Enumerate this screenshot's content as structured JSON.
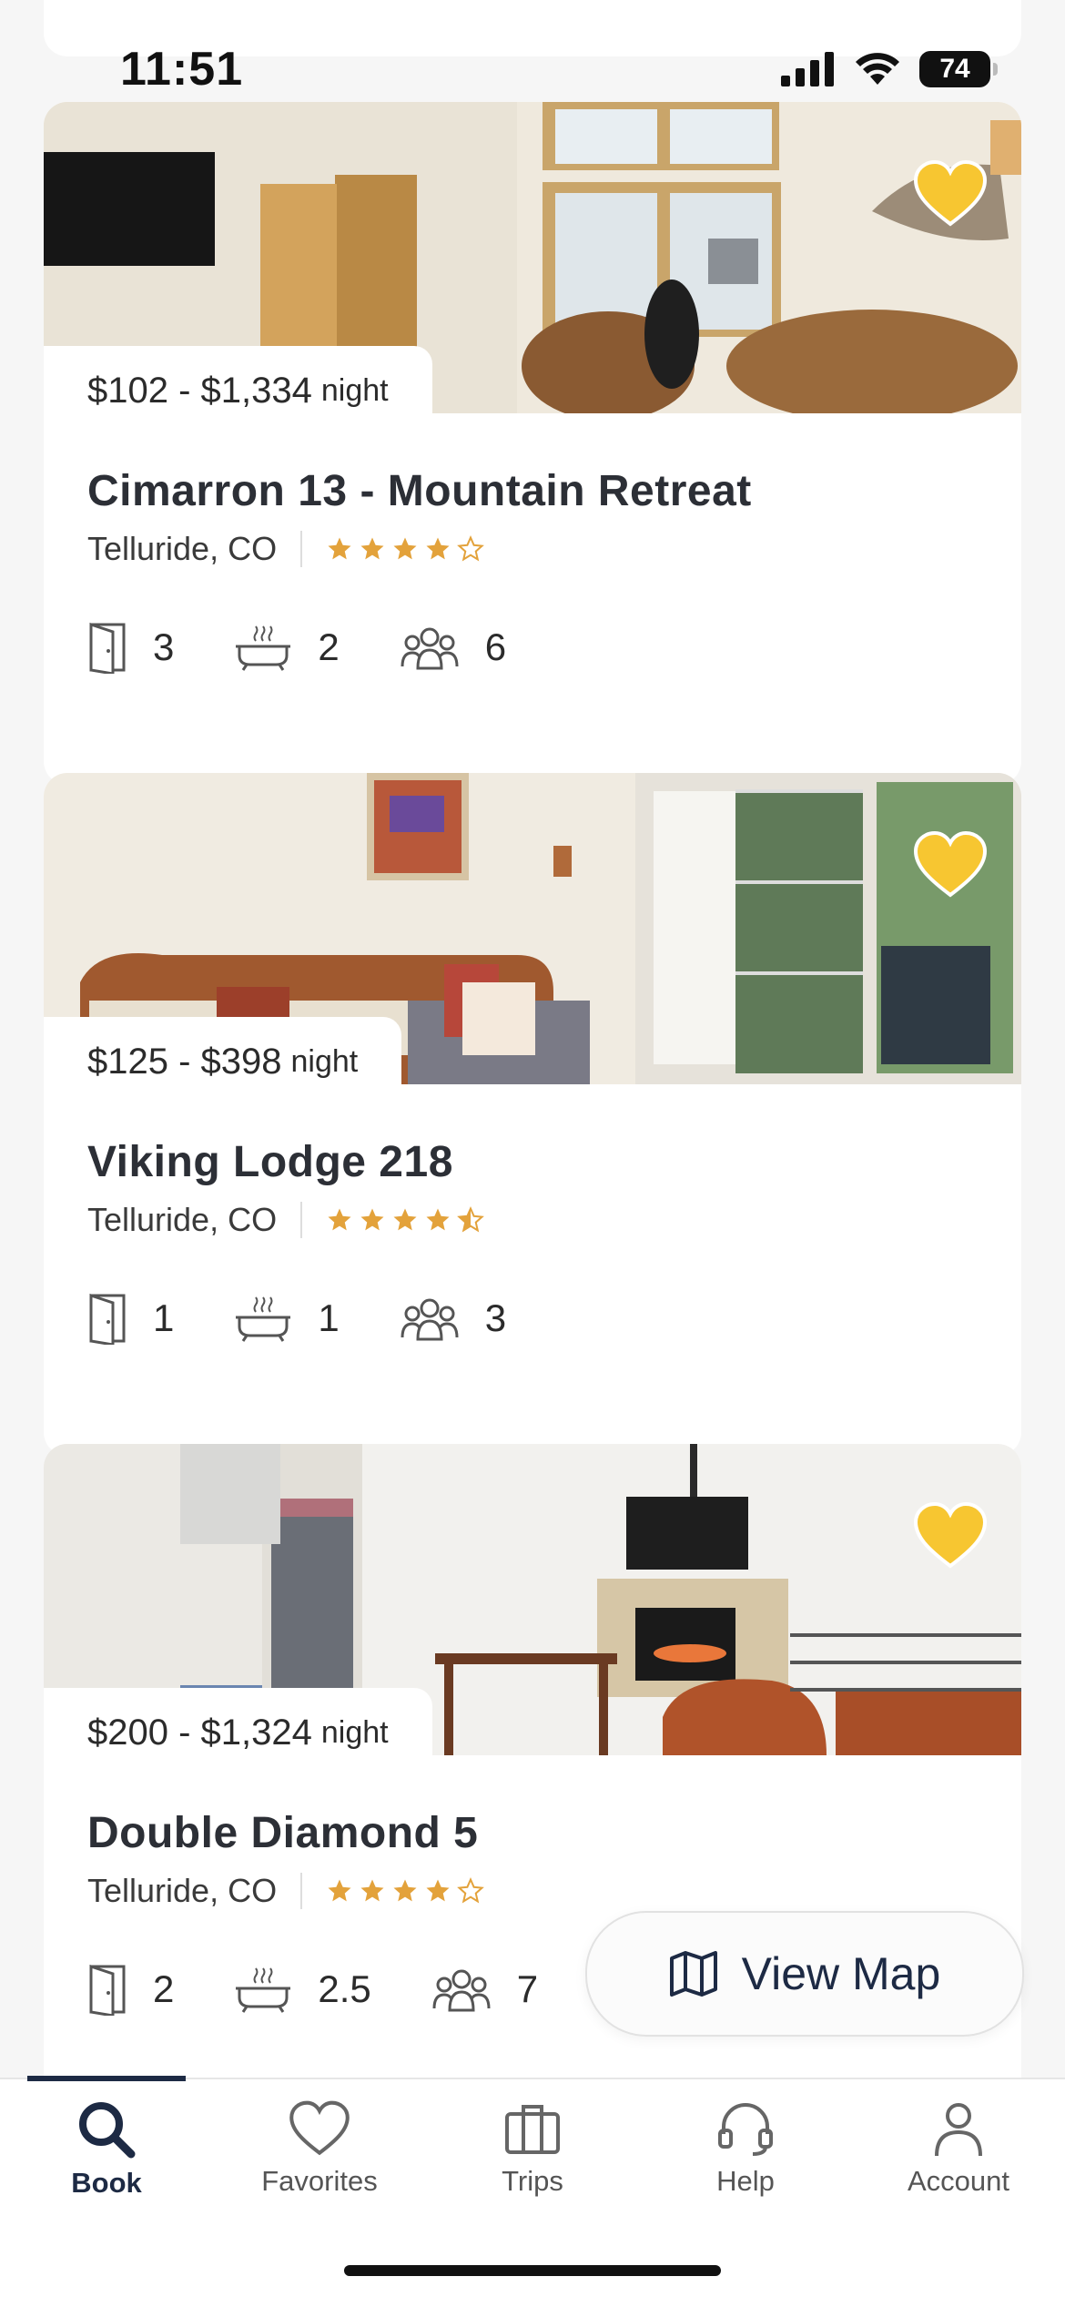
{
  "status_bar": {
    "time": "11:51",
    "battery": "74"
  },
  "listings": [
    {
      "price": "$102 - $1,334",
      "price_unit": "night",
      "title": "Cimarron 13 - Mountain Retreat",
      "location": "Telluride, CO",
      "rating": 4,
      "bedrooms": "3",
      "bathrooms": "2",
      "guests": "6",
      "favorited": true
    },
    {
      "price": "$125 - $398",
      "price_unit": "night",
      "title": "Viking Lodge 218",
      "location": "Telluride, CO",
      "rating": 4.5,
      "bedrooms": "1",
      "bathrooms": "1",
      "guests": "3",
      "favorited": true
    },
    {
      "price": "$200 - $1,324",
      "price_unit": "night",
      "title": "Double Diamond 5",
      "location": "Telluride, CO",
      "rating": 4,
      "bedrooms": "2",
      "bathrooms": "2.5",
      "guests": "7",
      "favorited": true
    }
  ],
  "view_map": {
    "label": "View Map"
  },
  "tabs": [
    {
      "label": "Book",
      "icon": "search-icon",
      "active": true
    },
    {
      "label": "Favorites",
      "icon": "heart-icon"
    },
    {
      "label": "Trips",
      "icon": "briefcase-icon"
    },
    {
      "label": "Help",
      "icon": "headset-icon"
    },
    {
      "label": "Account",
      "icon": "person-icon"
    }
  ],
  "colors": {
    "accent": "#1d2a44",
    "favorite": "#f7c631",
    "star": "#e3a23b"
  }
}
